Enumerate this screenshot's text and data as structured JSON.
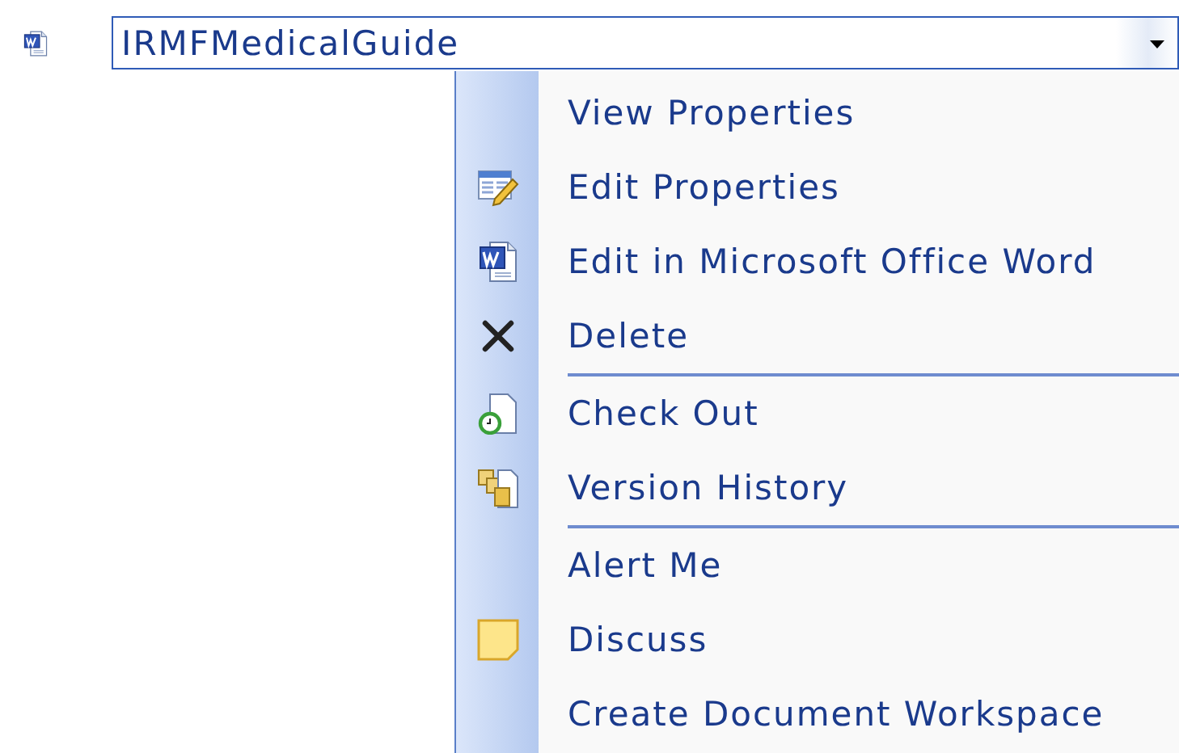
{
  "document": {
    "title": "IRMFMedicalGuide"
  },
  "menu": {
    "items": [
      {
        "label": "View Properties",
        "kind": "none"
      },
      {
        "label": "Edit Properties",
        "kind": "edit-form"
      },
      {
        "label": "Edit in Microsoft Office Word",
        "kind": "word"
      },
      {
        "label": "Delete",
        "kind": "delete"
      },
      {
        "kind": "separator"
      },
      {
        "label": "Check Out",
        "kind": "checkout"
      },
      {
        "label": "Version History",
        "kind": "versions"
      },
      {
        "kind": "separator"
      },
      {
        "label": "Alert Me",
        "kind": "none"
      },
      {
        "label": "Discuss",
        "kind": "note"
      },
      {
        "label": "Create Document Workspace",
        "kind": "none"
      }
    ]
  }
}
